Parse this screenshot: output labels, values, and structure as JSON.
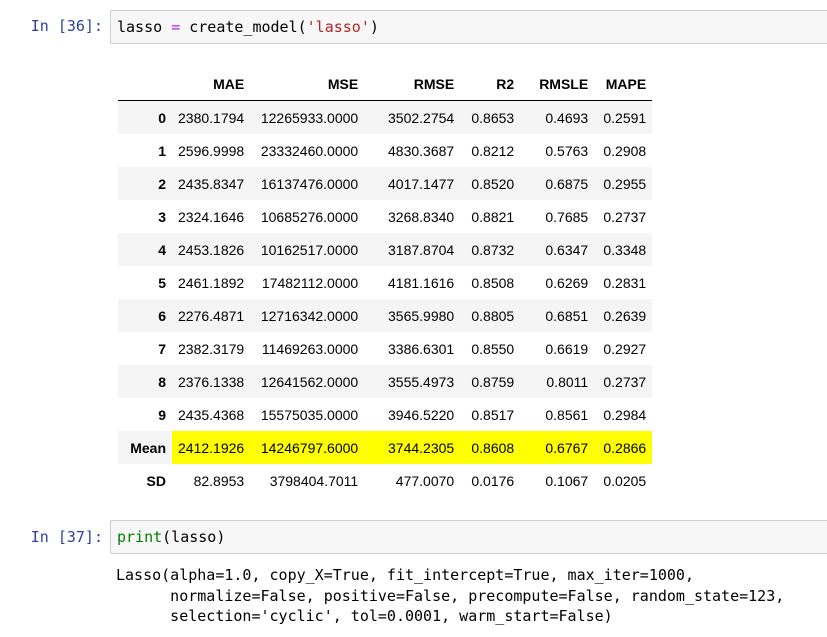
{
  "cells": [
    {
      "prompt": "In [36]:",
      "code": {
        "var": "lasso",
        "op": "=",
        "func": "create_model(",
        "arg": "'lasso'",
        "close": ")"
      }
    },
    {
      "prompt": "In [37]:",
      "code": {
        "func": "print",
        "args": "(lasso)"
      },
      "output": [
        "Lasso(alpha=1.0, copy_X=True, fit_intercept=True, max_iter=1000,",
        "      normalize=False, positive=False, precompute=False, random_state=123,",
        "      selection='cyclic', tol=0.0001, warm_start=False)"
      ]
    }
  ],
  "table": {
    "columns": [
      "MAE",
      "MSE",
      "RMSE",
      "R2",
      "RMSLE",
      "MAPE"
    ],
    "rows": [
      {
        "index": "0",
        "values": [
          "2380.1794",
          "12265933.0000",
          "3502.2754",
          "0.8653",
          "0.4693",
          "0.2591"
        ]
      },
      {
        "index": "1",
        "values": [
          "2596.9998",
          "23332460.0000",
          "4830.3687",
          "0.8212",
          "0.5763",
          "0.2908"
        ]
      },
      {
        "index": "2",
        "values": [
          "2435.8347",
          "16137476.0000",
          "4017.1477",
          "0.8520",
          "0.6875",
          "0.2955"
        ]
      },
      {
        "index": "3",
        "values": [
          "2324.1646",
          "10685276.0000",
          "3268.8340",
          "0.8821",
          "0.7685",
          "0.2737"
        ]
      },
      {
        "index": "4",
        "values": [
          "2453.1826",
          "10162517.0000",
          "3187.8704",
          "0.8732",
          "0.6347",
          "0.3348"
        ]
      },
      {
        "index": "5",
        "values": [
          "2461.1892",
          "17482112.0000",
          "4181.1616",
          "0.8508",
          "0.6269",
          "0.2831"
        ]
      },
      {
        "index": "6",
        "values": [
          "2276.4871",
          "12716342.0000",
          "3565.9980",
          "0.8805",
          "0.6851",
          "0.2639"
        ]
      },
      {
        "index": "7",
        "values": [
          "2382.3179",
          "11469263.0000",
          "3386.6301",
          "0.8550",
          "0.6619",
          "0.2927"
        ]
      },
      {
        "index": "8",
        "values": [
          "2376.1338",
          "12641562.0000",
          "3555.4973",
          "0.8759",
          "0.8011",
          "0.2737"
        ]
      },
      {
        "index": "9",
        "values": [
          "2435.4368",
          "15575035.0000",
          "3946.5220",
          "0.8517",
          "0.8561",
          "0.2984"
        ]
      },
      {
        "index": "Mean",
        "values": [
          "2412.1926",
          "14246797.6000",
          "3744.2305",
          "0.8608",
          "0.6767",
          "0.2866"
        ],
        "highlight": true
      },
      {
        "index": "SD",
        "values": [
          "82.8953",
          "3798404.7011",
          "477.0070",
          "0.0176",
          "0.1067",
          "0.0205"
        ]
      }
    ]
  },
  "colors": {
    "prompt": "#303f9f",
    "highlight": "#ffff00",
    "stripe": "#f5f5f5",
    "cell_bg": "#f7f7f7",
    "keyword_print": "#008000",
    "string": "#ba2121",
    "operator": "#aa22ff"
  }
}
